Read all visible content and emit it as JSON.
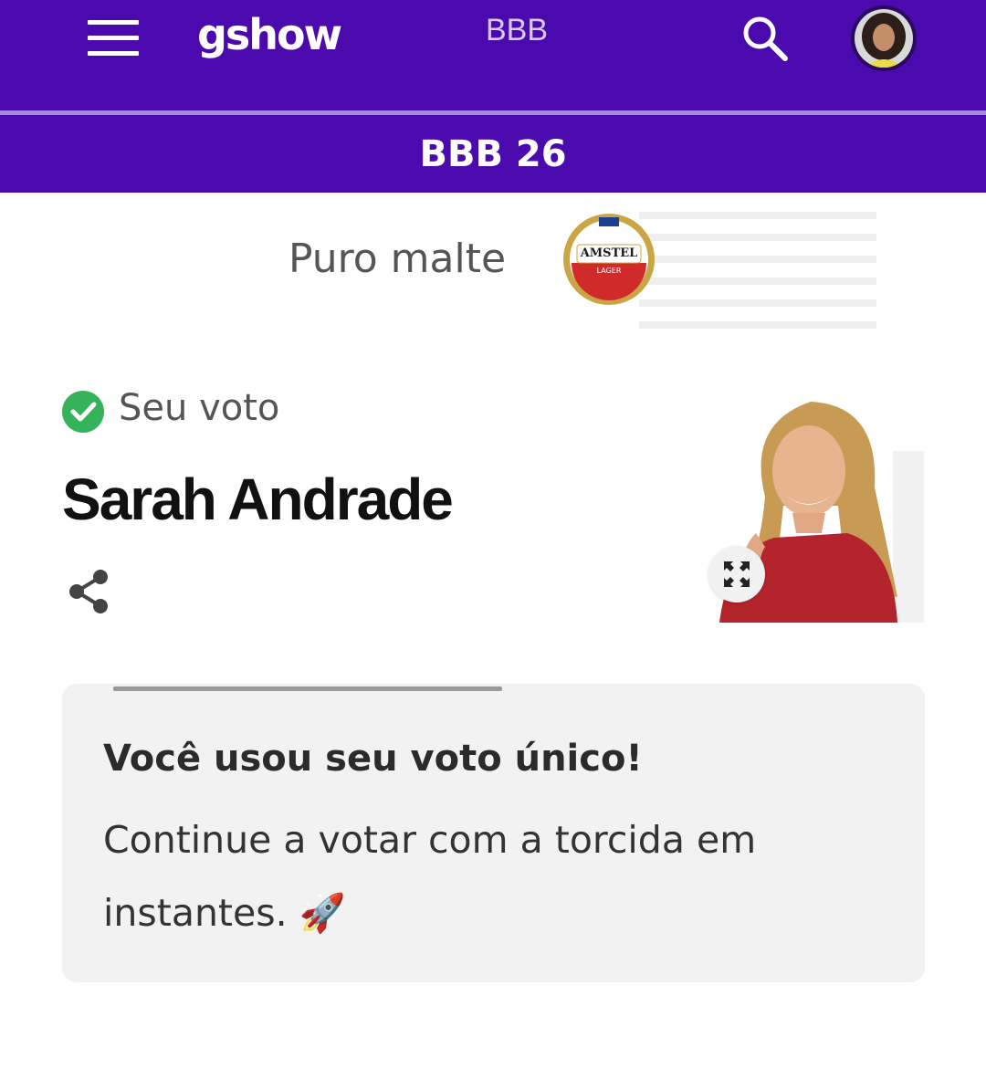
{
  "header": {
    "logo_text": "gshow",
    "nav_link": "BBB",
    "icons": [
      "menu-icon",
      "search-icon",
      "user-avatar"
    ],
    "colors": {
      "brand": "#4b0aae",
      "divider": "#a58ad9"
    }
  },
  "section": {
    "title": "BBB 26"
  },
  "sponsor": {
    "tagline": "Puro malte",
    "logo_text": "AMSTEL",
    "logo_subtext": "LAGER"
  },
  "vote": {
    "status_label": "Seu voto",
    "candidate_name": "Sarah Andrade",
    "status_color": "#35b35a"
  },
  "card": {
    "title": "Você usou seu voto único!",
    "body": "Continue a votar com a torcida em instantes.",
    "emoji": "🚀"
  }
}
